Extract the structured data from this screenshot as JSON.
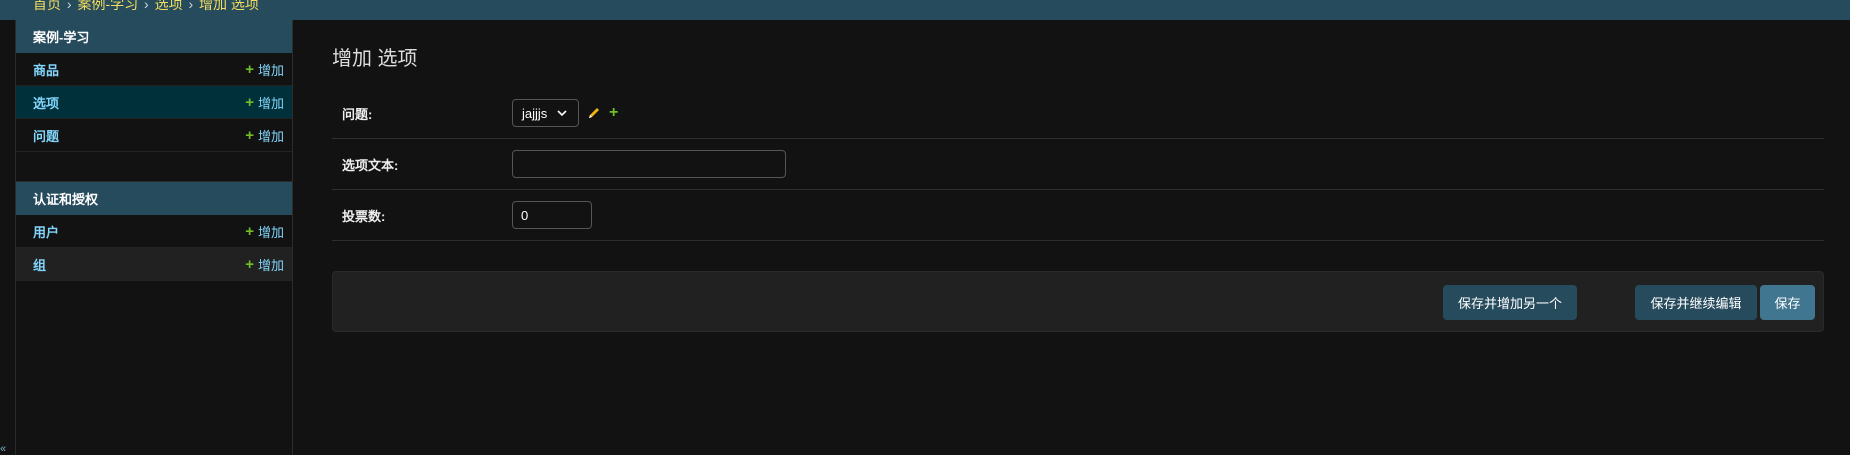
{
  "breadcrumb": {
    "home": "首页",
    "app": "案例-学习",
    "model": "选项",
    "current": "增加 选项",
    "separator": "›"
  },
  "sidebar": {
    "modules": [
      {
        "caption": "案例-学习",
        "items": [
          {
            "label": "商品",
            "add_label": "增加"
          },
          {
            "label": "选项",
            "add_label": "增加"
          },
          {
            "label": "问题",
            "add_label": "增加"
          }
        ]
      },
      {
        "caption": "认证和授权",
        "items": [
          {
            "label": "用户",
            "add_label": "增加"
          },
          {
            "label": "组",
            "add_label": "增加"
          }
        ]
      }
    ],
    "collapse_glyph": "«"
  },
  "page": {
    "title": "增加 选项"
  },
  "form": {
    "question_label": "问题:",
    "question_selected": "jajjjs",
    "choice_text_label": "选项文本:",
    "choice_text_value": "",
    "votes_label": "投票数:",
    "votes_value": "0"
  },
  "actions": {
    "save_add_another": "保存并增加另一个",
    "save_continue": "保存并继续编辑",
    "save": "保存"
  },
  "colors": {
    "header": "#264b5d",
    "selected_row": "#00313b",
    "link": "#81d4fa",
    "add_icon": "#70bf2b",
    "breadcrumb": "#f5dd5d",
    "default_button": "#417690"
  }
}
